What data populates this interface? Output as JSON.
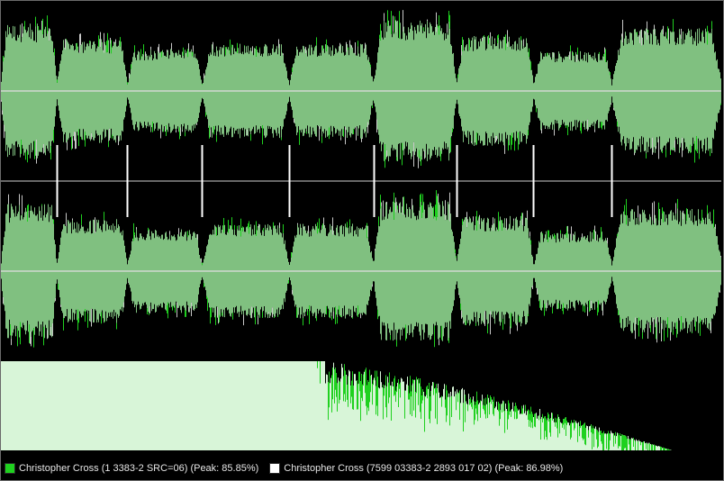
{
  "legend": {
    "item1": {
      "label": "Christopher Cross (1 3383-2 SRC=06) (Peak: 85.85%)",
      "color": "#1fd11f"
    },
    "item2": {
      "label": "Christopher Cross (7599 03383-2 2893 017 02) (Peak: 86.98%)",
      "color": "#ffffff"
    }
  },
  "colors": {
    "background": "#000000",
    "waveform_fill": "#80c080",
    "waveform_peak_green": "#1fd11f",
    "waveform_peak_white": "#c8c8c8",
    "spectrum_fill": "#d8f5d8",
    "spectrum_peak": "#1fd11f",
    "divider": "#8a8a8a",
    "track_marker": "#ffffff"
  },
  "tracks": {
    "relative_lengths": [
      0.077,
      0.098,
      0.104,
      0.121,
      0.117,
      0.115,
      0.107,
      0.109,
      0.152
    ],
    "relative_levels": [
      0.88,
      0.68,
      0.55,
      0.62,
      0.62,
      0.92,
      0.72,
      0.52,
      0.82
    ]
  }
}
